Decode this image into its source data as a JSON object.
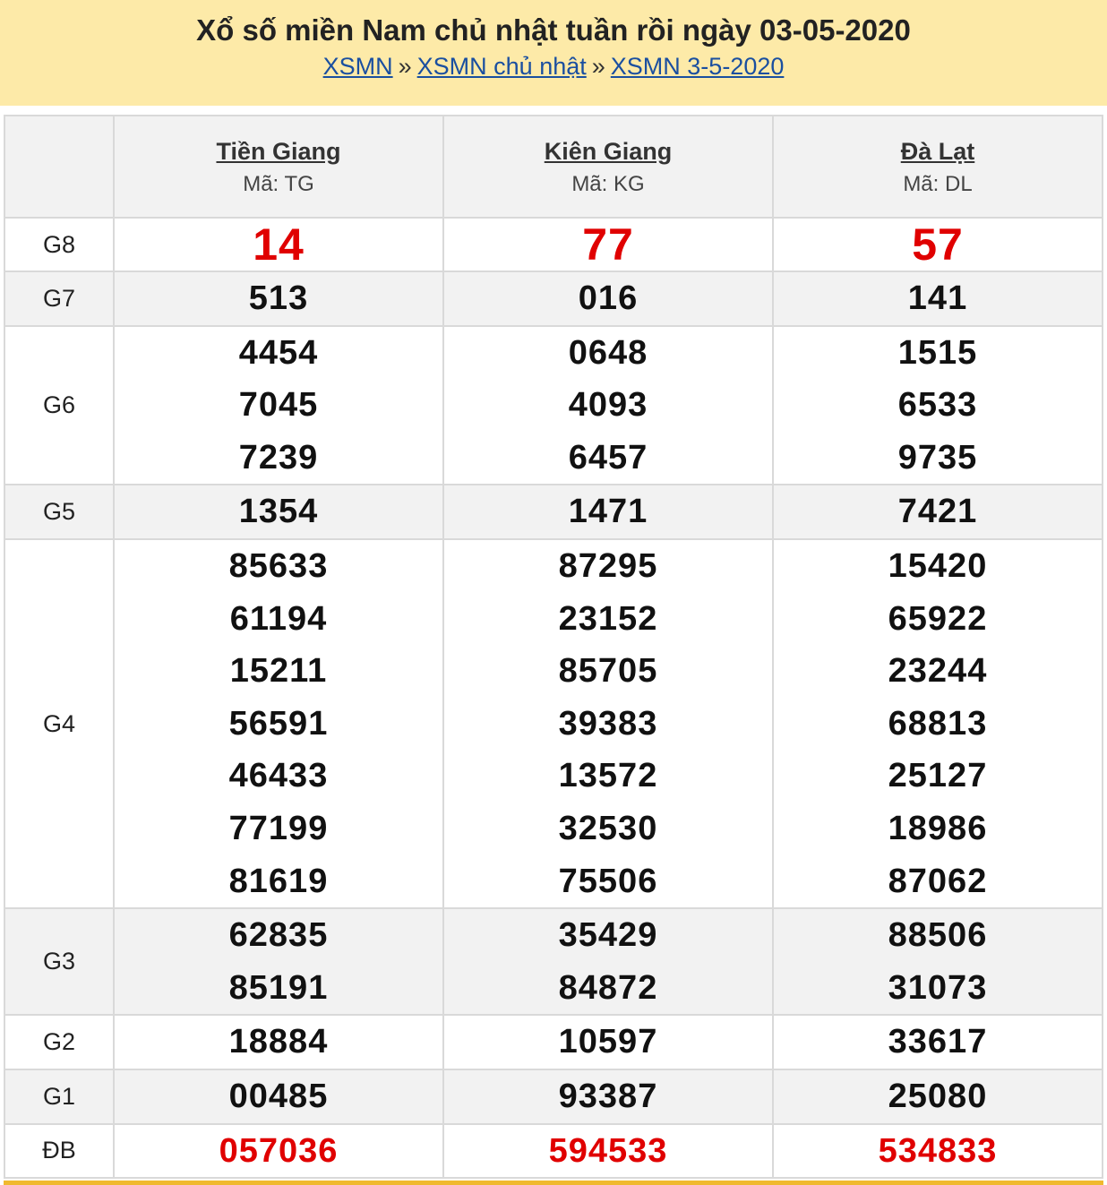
{
  "header": {
    "title": "Xổ số miền Nam chủ nhật tuần rồi ngày 03-05-2020",
    "breadcrumb": [
      "XSMN",
      "XSMN chủ nhật",
      "XSMN 3-5-2020"
    ],
    "separator": "»"
  },
  "provinces": [
    {
      "name": "Tiền Giang",
      "code": "Mã: TG"
    },
    {
      "name": "Kiên Giang",
      "code": "Mã: KG"
    },
    {
      "name": "Đà Lạt",
      "code": "Mã: DL"
    }
  ],
  "prizes": {
    "G8": {
      "label": "G8",
      "values": [
        [
          "14"
        ],
        [
          "77"
        ],
        [
          "57"
        ]
      ]
    },
    "G7": {
      "label": "G7",
      "values": [
        [
          "513"
        ],
        [
          "016"
        ],
        [
          "141"
        ]
      ]
    },
    "G6": {
      "label": "G6",
      "values": [
        [
          "4454",
          "7045",
          "7239"
        ],
        [
          "0648",
          "4093",
          "6457"
        ],
        [
          "1515",
          "6533",
          "9735"
        ]
      ]
    },
    "G5": {
      "label": "G5",
      "values": [
        [
          "1354"
        ],
        [
          "1471"
        ],
        [
          "7421"
        ]
      ]
    },
    "G4": {
      "label": "G4",
      "values": [
        [
          "85633",
          "61194",
          "15211",
          "56591",
          "46433",
          "77199",
          "81619"
        ],
        [
          "87295",
          "23152",
          "85705",
          "39383",
          "13572",
          "32530",
          "75506"
        ],
        [
          "15420",
          "65922",
          "23244",
          "68813",
          "25127",
          "18986",
          "87062"
        ]
      ]
    },
    "G3": {
      "label": "G3",
      "values": [
        [
          "62835",
          "85191"
        ],
        [
          "35429",
          "84872"
        ],
        [
          "88506",
          "31073"
        ]
      ]
    },
    "G2": {
      "label": "G2",
      "values": [
        [
          "18884"
        ],
        [
          "10597"
        ],
        [
          "33617"
        ]
      ]
    },
    "G1": {
      "label": "G1",
      "values": [
        [
          "00485"
        ],
        [
          "93387"
        ],
        [
          "25080"
        ]
      ]
    },
    "DB": {
      "label": "ĐB",
      "values": [
        [
          "057036"
        ],
        [
          "594533"
        ],
        [
          "534833"
        ]
      ]
    }
  },
  "colors": {
    "header_bg": "#fdeaa8",
    "highlight": "#e00000",
    "link": "#1a4fa0",
    "row_alt": "#f2f2f2",
    "accent_bar": "#f0b92f"
  }
}
